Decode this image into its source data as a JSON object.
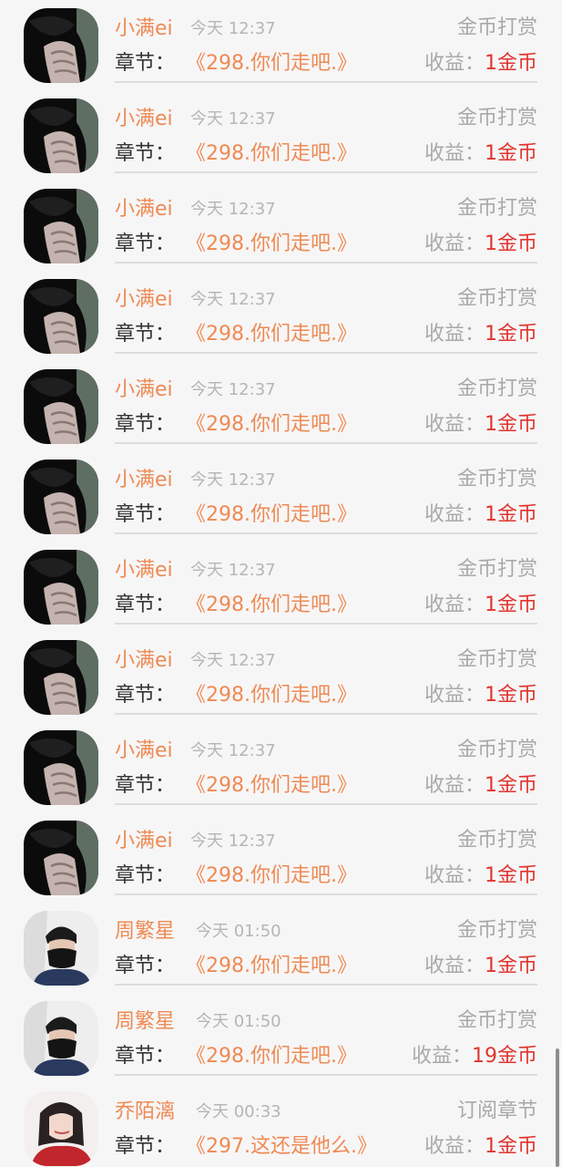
{
  "list": [
    {
      "avatar": "dark-hood-avatar",
      "name": "小满ei",
      "time": "今天 12:37",
      "type": "金币打赏",
      "chapter_label": "章节：",
      "chapter": "《298.你们走吧.》",
      "income_label": "收益：",
      "income": "1金币"
    },
    {
      "avatar": "dark-hood-avatar",
      "name": "小满ei",
      "time": "今天 12:37",
      "type": "金币打赏",
      "chapter_label": "章节：",
      "chapter": "《298.你们走吧.》",
      "income_label": "收益：",
      "income": "1金币"
    },
    {
      "avatar": "dark-hood-avatar",
      "name": "小满ei",
      "time": "今天 12:37",
      "type": "金币打赏",
      "chapter_label": "章节：",
      "chapter": "《298.你们走吧.》",
      "income_label": "收益：",
      "income": "1金币"
    },
    {
      "avatar": "dark-hood-avatar",
      "name": "小满ei",
      "time": "今天 12:37",
      "type": "金币打赏",
      "chapter_label": "章节：",
      "chapter": "《298.你们走吧.》",
      "income_label": "收益：",
      "income": "1金币"
    },
    {
      "avatar": "dark-hood-avatar",
      "name": "小满ei",
      "time": "今天 12:37",
      "type": "金币打赏",
      "chapter_label": "章节：",
      "chapter": "《298.你们走吧.》",
      "income_label": "收益：",
      "income": "1金币"
    },
    {
      "avatar": "dark-hood-avatar",
      "name": "小满ei",
      "time": "今天 12:37",
      "type": "金币打赏",
      "chapter_label": "章节：",
      "chapter": "《298.你们走吧.》",
      "income_label": "收益：",
      "income": "1金币"
    },
    {
      "avatar": "dark-hood-avatar",
      "name": "小满ei",
      "time": "今天 12:37",
      "type": "金币打赏",
      "chapter_label": "章节：",
      "chapter": "《298.你们走吧.》",
      "income_label": "收益：",
      "income": "1金币"
    },
    {
      "avatar": "dark-hood-avatar",
      "name": "小满ei",
      "time": "今天 12:37",
      "type": "金币打赏",
      "chapter_label": "章节：",
      "chapter": "《298.你们走吧.》",
      "income_label": "收益：",
      "income": "1金币"
    },
    {
      "avatar": "dark-hood-avatar",
      "name": "小满ei",
      "time": "今天 12:37",
      "type": "金币打赏",
      "chapter_label": "章节：",
      "chapter": "《298.你们走吧.》",
      "income_label": "收益：",
      "income": "1金币"
    },
    {
      "avatar": "dark-hood-avatar",
      "name": "小满ei",
      "time": "今天 12:37",
      "type": "金币打赏",
      "chapter_label": "章节：",
      "chapter": "《298.你们走吧.》",
      "income_label": "收益：",
      "income": "1金币"
    },
    {
      "avatar": "masked-man-avatar",
      "name": "周繁星",
      "time": "今天 01:50",
      "type": "金币打赏",
      "chapter_label": "章节：",
      "chapter": "《298.你们走吧.》",
      "income_label": "收益：",
      "income": "1金币"
    },
    {
      "avatar": "masked-man-avatar",
      "name": "周繁星",
      "time": "今天 01:50",
      "type": "金币打赏",
      "chapter_label": "章节：",
      "chapter": "《298.你们走吧.》",
      "income_label": "收益：",
      "income": "19金币"
    },
    {
      "avatar": "girl-red-avatar",
      "name": "乔陌漓",
      "time": "今天 00:33",
      "type": "订阅章节",
      "chapter_label": "章节：",
      "chapter": "《297.这还是他么.》",
      "income_label": "收益：",
      "income": "1金币"
    }
  ],
  "colors": {
    "name": "#ee8a53",
    "chapter": "#ee8a53",
    "income": "#e0352f",
    "muted": "#a9a9a9",
    "label": "#333333",
    "background": "#f7f6f7"
  }
}
